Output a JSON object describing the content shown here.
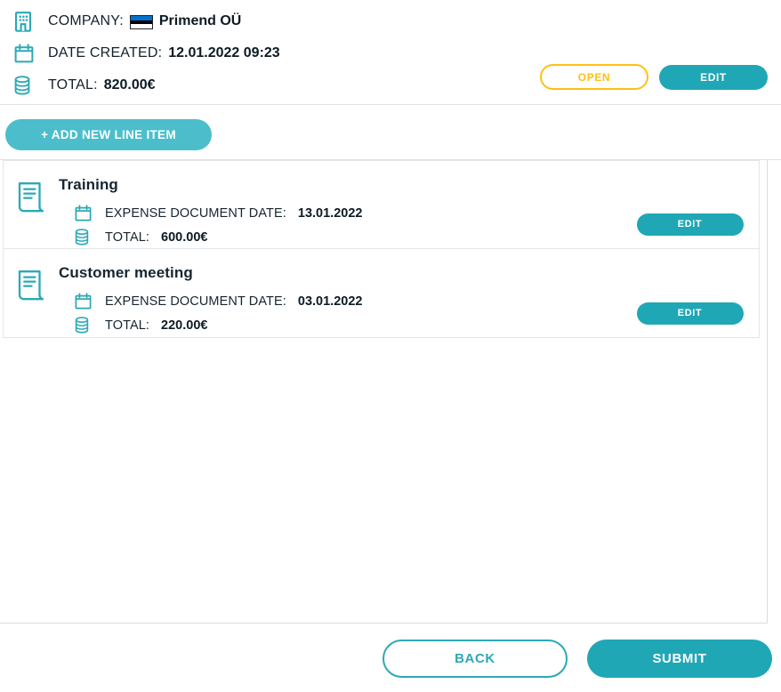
{
  "summary": {
    "company": {
      "icon": "building-icon",
      "label": "COMPANY:",
      "flag": "estonia-flag",
      "value": "Primend OÜ"
    },
    "date_created": {
      "icon": "calendar-icon",
      "label": "DATE CREATED:",
      "value": "12.01.2022 09:23"
    },
    "total": {
      "icon": "database-icon",
      "label": "TOTAL:",
      "value": "820.00€"
    },
    "status_label": "OPEN",
    "edit_label": "EDIT"
  },
  "toolbar": {
    "add_line_item_label": "+ ADD NEW LINE ITEM"
  },
  "line_items": [
    {
      "title": "Training",
      "doc_icon": "document-icon",
      "date_icon": "calendar-icon",
      "date_label": "EXPENSE DOCUMENT DATE:",
      "date_value": "13.01.2022",
      "total_icon": "database-icon",
      "total_label": "TOTAL:",
      "total_value": "600.00€",
      "edit_label": "EDIT"
    },
    {
      "title": "Customer meeting",
      "doc_icon": "document-icon",
      "date_icon": "calendar-icon",
      "date_label": "EXPENSE DOCUMENT DATE:",
      "date_value": "03.01.2022",
      "total_icon": "database-icon",
      "total_label": "TOTAL:",
      "total_value": "220.00€",
      "edit_label": "EDIT"
    }
  ],
  "footer": {
    "back_label": "BACK",
    "submit_label": "SUBMIT"
  },
  "colors": {
    "teal": "#20A7B6",
    "teal_light": "#4CBECB",
    "amber": "#FFC014",
    "text": "#17252f",
    "border": "#e2e6e8"
  }
}
